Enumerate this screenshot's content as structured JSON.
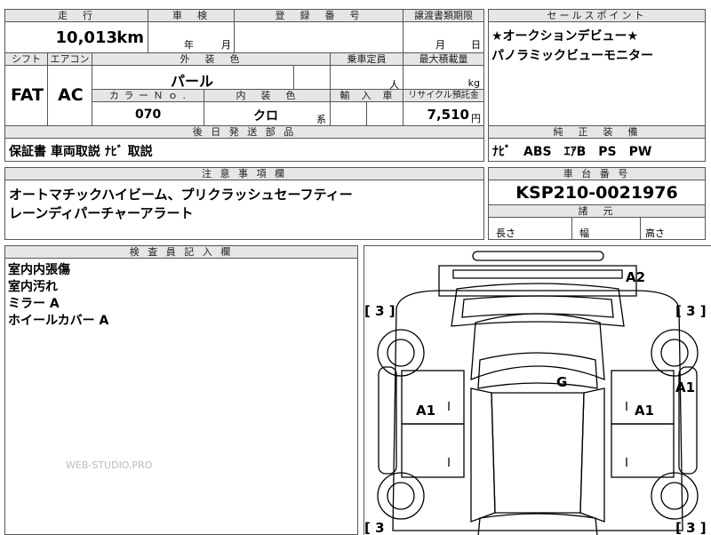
{
  "top_row": {
    "mileage_label": "走　行",
    "mileage_value": "10,013",
    "mileage_unit": "km",
    "inspection_label": "車　検",
    "inspection_year_unit": "年",
    "inspection_month_unit": "月",
    "registration_label": "登　録　番　号",
    "transfer_deadline_label": "譲渡書類期限",
    "transfer_month_unit": "月",
    "transfer_day_unit": "日"
  },
  "second_row": {
    "shift_label": "シフト",
    "shift_value": "FAT",
    "ac_label": "エアコン",
    "ac_value": "AC",
    "exterior_color_label": "外　装　色",
    "exterior_color_value": "パール",
    "capacity_label": "乗車定員",
    "capacity_unit": "人",
    "max_load_label": "最大積載量",
    "max_load_unit": "kg",
    "color_no_label": "カ ラ ー Ｎ ｏ .",
    "color_no_value": "070",
    "interior_color_label": "内　装　色",
    "interior_color_value": "クロ",
    "interior_suffix": "系",
    "import_label": "輸　入　車",
    "recycle_label": "リサイクル預託金",
    "recycle_value": "7,510",
    "recycle_unit": "円"
  },
  "sales_points": {
    "label": "セールスポイント",
    "lines": [
      "★オークションデビュー★",
      "パノラミックビューモニター"
    ]
  },
  "later_parts": {
    "label": "後 日 発 送 部 品",
    "value": "保証書 車両取説 ﾅﾋﾞ 取説"
  },
  "genuine_equipment": {
    "label": "純　正　装　備",
    "value": "ﾅﾋﾞ　ABS　ｴｱB　PS　PW"
  },
  "notes": {
    "label": "注 意 事 項 欄",
    "lines": [
      "オートマチックハイビーム、プリクラッシュセーフティー",
      "レーンディパーチャーアラート"
    ]
  },
  "chassis": {
    "label": "車 台 番 号",
    "value": "KSP210-0021976"
  },
  "dimensions": {
    "label": "諸　元",
    "length_label": "長さ",
    "width_label": "幅",
    "height_label": "高さ"
  },
  "inspector": {
    "label": "検 査 員 記 入 欄",
    "lines": [
      "室内内張傷",
      "室内汚れ",
      "ミラー A",
      "ホイールカバー A"
    ]
  },
  "watermark": "WEB-STUDIO.PRO",
  "diagram": {
    "mark_front": "A2",
    "mark_center": "G",
    "mark_left_door": "A1",
    "mark_right_door": "A1",
    "mark_right_side": "A1",
    "tire_tl": "[ 3 ]",
    "tire_tr": "[ 3 ]",
    "tire_bl": "[ 3",
    "tire_br": "[ 3 ]"
  }
}
